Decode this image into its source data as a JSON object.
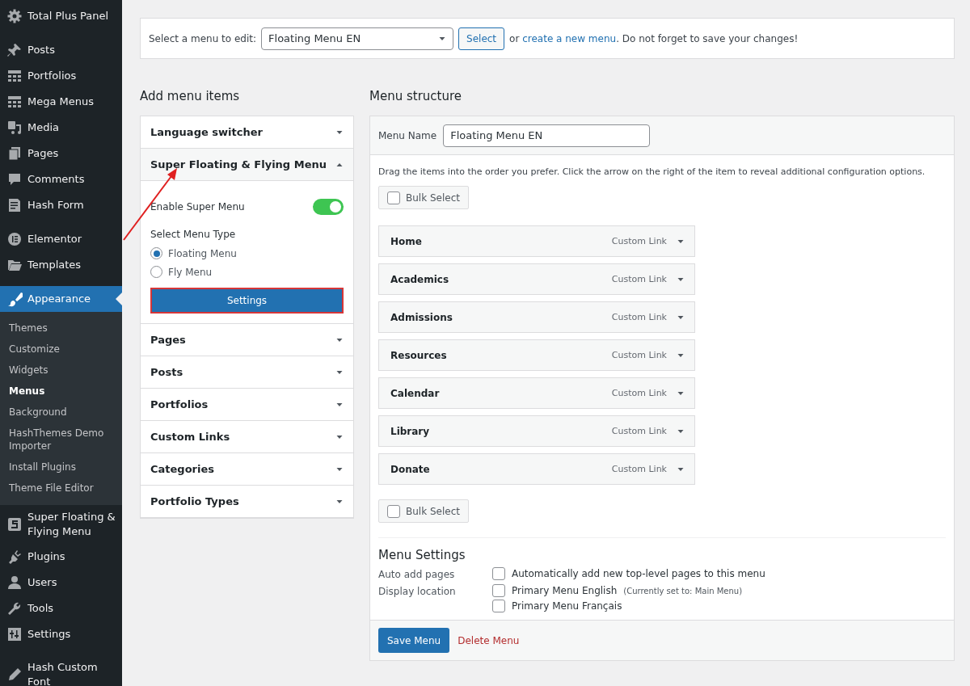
{
  "sidebar": {
    "groups": [
      [
        {
          "label": "Total Plus Panel",
          "selected": false
        }
      ],
      [
        {
          "label": "Posts",
          "selected": false
        },
        {
          "label": "Portfolios",
          "selected": false
        },
        {
          "label": "Mega Menus",
          "selected": false
        },
        {
          "label": "Media",
          "selected": false
        },
        {
          "label": "Pages",
          "selected": false
        },
        {
          "label": "Comments",
          "selected": false
        },
        {
          "label": "Hash Form",
          "selected": false
        }
      ],
      [
        {
          "label": "Elementor",
          "selected": false
        },
        {
          "label": "Templates",
          "selected": false
        }
      ],
      [
        {
          "label": "Appearance",
          "selected": true,
          "children": [
            {
              "label": "Themes",
              "selected": false
            },
            {
              "label": "Customize",
              "selected": false
            },
            {
              "label": "Widgets",
              "selected": false
            },
            {
              "label": "Menus",
              "selected": true
            },
            {
              "label": "Background",
              "selected": false
            },
            {
              "label": "HashThemes Demo Importer",
              "selected": false
            },
            {
              "label": "Install Plugins",
              "selected": false
            },
            {
              "label": "Theme File Editor",
              "selected": false
            }
          ]
        },
        {
          "label": "Super Floating & Flying Menu",
          "selected": false
        },
        {
          "label": "Plugins",
          "selected": false
        },
        {
          "label": "Users",
          "selected": false
        },
        {
          "label": "Tools",
          "selected": false
        },
        {
          "label": "Settings",
          "selected": false
        }
      ],
      [
        {
          "label": "Hash Custom Font",
          "selected": false
        }
      ]
    ]
  },
  "menu_selector": {
    "label": "Select a menu to edit:",
    "value": "Floating Menu EN",
    "button": "Select",
    "text_before": "or",
    "link": "create a new menu",
    "text_after": ". Do not forget to save your changes!"
  },
  "add_menu_items": {
    "title": "Add menu items",
    "sections": [
      {
        "title": "Language switcher",
        "expanded": false
      },
      {
        "title": "Super Floating & Flying Menu",
        "expanded": true,
        "toggle": {
          "label": "Enable Super Menu",
          "on": true
        },
        "radio_label": "Select Menu Type",
        "options": [
          {
            "label": "Floating Menu",
            "selected": true
          },
          {
            "label": "Fly Menu",
            "selected": false
          }
        ],
        "button": "Settings"
      },
      {
        "title": "Pages",
        "expanded": false
      },
      {
        "title": "Posts",
        "expanded": false
      },
      {
        "title": "Portfolios",
        "expanded": false
      },
      {
        "title": "Custom Links",
        "expanded": false
      },
      {
        "title": "Categories",
        "expanded": false
      },
      {
        "title": "Portfolio Types",
        "expanded": false
      }
    ]
  },
  "menu_structure": {
    "title": "Menu structure",
    "name_label": "Menu Name",
    "name_value": "Floating Menu EN",
    "instructions": "Drag the items into the order you prefer. Click the arrow on the right of the item to reveal additional configuration options.",
    "bulk_select": [
      {
        "label": "Bulk Select",
        "checked": false
      },
      {
        "label": "Bulk Select",
        "checked": false
      }
    ],
    "items": [
      {
        "title": "Home",
        "type": "Custom Link"
      },
      {
        "title": "Academics",
        "type": "Custom Link"
      },
      {
        "title": "Admissions",
        "type": "Custom Link"
      },
      {
        "title": "Resources",
        "type": "Custom Link"
      },
      {
        "title": "Calendar",
        "type": "Custom Link"
      },
      {
        "title": "Library",
        "type": "Custom Link"
      },
      {
        "title": "Donate",
        "type": "Custom Link"
      }
    ],
    "settings": {
      "title": "Menu Settings",
      "rows": [
        {
          "label": "Auto add pages",
          "options": [
            {
              "label": "Automatically add new top-level pages to this menu",
              "checked": false
            }
          ]
        },
        {
          "label": "Display location",
          "options": [
            {
              "label": "Primary Menu English",
              "note": "(Currently set to: Main Menu)",
              "checked": false
            },
            {
              "label": "Primary Menu Français",
              "checked": false
            }
          ]
        }
      ]
    },
    "save_button": "Save Menu",
    "delete_link": "Delete Menu"
  }
}
